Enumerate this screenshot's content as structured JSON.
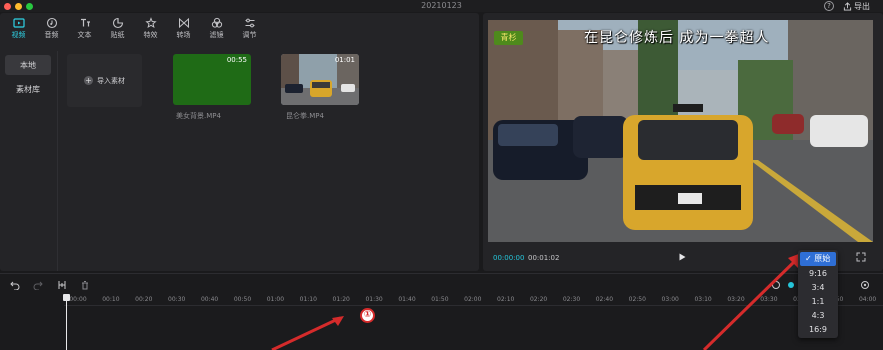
{
  "window": {
    "title": "20210123",
    "export_label": "导出",
    "help_label": "?"
  },
  "toolbar": {
    "tabs": [
      {
        "label": "视频",
        "icon": "video-icon",
        "active": true
      },
      {
        "label": "音频",
        "icon": "audio-icon"
      },
      {
        "label": "文本",
        "icon": "text-icon"
      },
      {
        "label": "贴纸",
        "icon": "sticker-icon"
      },
      {
        "label": "特效",
        "icon": "effects-icon"
      },
      {
        "label": "转场",
        "icon": "transition-icon"
      },
      {
        "label": "滤镜",
        "icon": "filter-icon"
      },
      {
        "label": "调节",
        "icon": "adjust-icon"
      }
    ]
  },
  "media": {
    "sidebar": [
      {
        "label": "本地",
        "active": true
      },
      {
        "label": "素材库"
      }
    ],
    "import_label": "导入素材",
    "clips": [
      {
        "name": "美女背景.MP4",
        "duration": "00:55"
      },
      {
        "name": "昆仑拳.MP4",
        "duration": "01:01"
      }
    ]
  },
  "player": {
    "watermark": "青杉",
    "subtitle": "在昆仑修炼后 成为一拳超人",
    "current_time": "00:00:00",
    "total_time": "00:01:02"
  },
  "ratio_menu": {
    "options": [
      "原始",
      "9:16",
      "3:4",
      "1:1",
      "4:3",
      "16:9"
    ],
    "selected": "原始",
    "check": "✓"
  },
  "timeline": {
    "ticks": [
      "00:00",
      "00:10",
      "00:20",
      "00:30",
      "00:40",
      "00:50",
      "01:00",
      "01:10",
      "01:20",
      "01:30",
      "01:40",
      "01:50",
      "02:00",
      "02:10",
      "02:20",
      "02:30",
      "02:40",
      "02:50",
      "03:00",
      "03:10",
      "03:20",
      "03:30",
      "03:40",
      "03:50",
      "04:00"
    ]
  },
  "annotation": {
    "number": "①"
  },
  "colors": {
    "accent": "#2ed3e6",
    "timecode": "#26c6da",
    "menu_selected": "#2f6fd6",
    "annotation_red": "#d52b2b"
  }
}
